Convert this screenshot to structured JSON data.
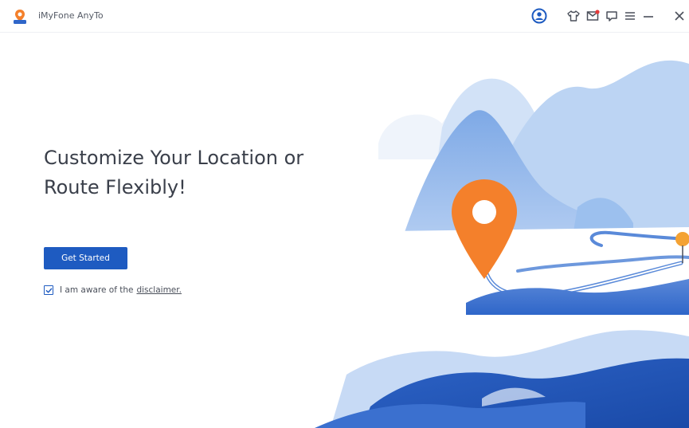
{
  "app": {
    "title": "iMyFone AnyTo"
  },
  "window_controls": {
    "account_icon": "account-icon",
    "shirt_icon": "shirt-icon",
    "mail_icon": "mail-icon",
    "feedback_icon": "feedback-icon",
    "menu_icon": "menu-icon",
    "minimize_icon": "minimize-icon",
    "close_icon": "close-icon"
  },
  "hero": {
    "headline_line1": "Customize Your Location or",
    "headline_line2": "Route Flexibly!",
    "cta_label": "Get Started",
    "agree_text": "I am aware of the",
    "disclaimer_label": "disclaimer.",
    "agreed": true
  },
  "colors": {
    "accent": "#1e5bc1",
    "pin": "#f4802b",
    "mountain_light": "#c9dcf5",
    "mountain_mid": "#8fb6ea",
    "mountain_dark": "#2f66c9"
  }
}
